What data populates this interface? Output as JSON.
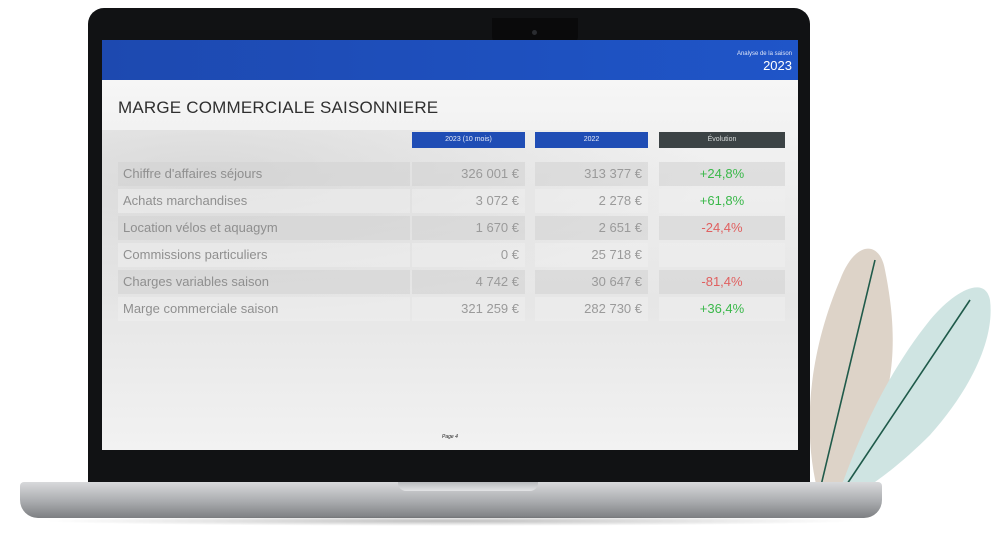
{
  "header": {
    "season_label": "Analyse de la saison",
    "year": "2023"
  },
  "slide": {
    "title": "MARGE COMMERCIALE SAISONNIERE",
    "columns": [
      "2023 (10 mois)",
      "2022",
      "Évolution"
    ],
    "rows": [
      {
        "label": "Chiffre d'affaires séjours",
        "v2023": "326 001 €",
        "v2022": "313 377 €",
        "evolution": "+24,8%",
        "trend": "positive"
      },
      {
        "label": "Achats marchandises",
        "v2023": "3 072 €",
        "v2022": "2 278 €",
        "evolution": "+61,8%",
        "trend": "positive"
      },
      {
        "label": "Location vélos et aquagym",
        "v2023": "1 670 €",
        "v2022": "2 651 €",
        "evolution": "-24,4%",
        "trend": "negative"
      },
      {
        "label": "Commissions particuliers",
        "v2023": "0 €",
        "v2022": "25 718 €",
        "evolution": "",
        "trend": "none"
      },
      {
        "label": "Charges variables saison",
        "v2023": "4 742 €",
        "v2022": "30 647 €",
        "evolution": "-81,4%",
        "trend": "negative"
      },
      {
        "label": "Marge commerciale saison",
        "v2023": "321 259 €",
        "v2022": "282 730 €",
        "evolution": "+36,4%",
        "trend": "positive"
      }
    ],
    "page": "Page 4"
  },
  "colors": {
    "header_blue": "#1f55c8",
    "evolution_header": "#3c4345",
    "positive": "#3ab84a",
    "negative": "#e06060"
  }
}
